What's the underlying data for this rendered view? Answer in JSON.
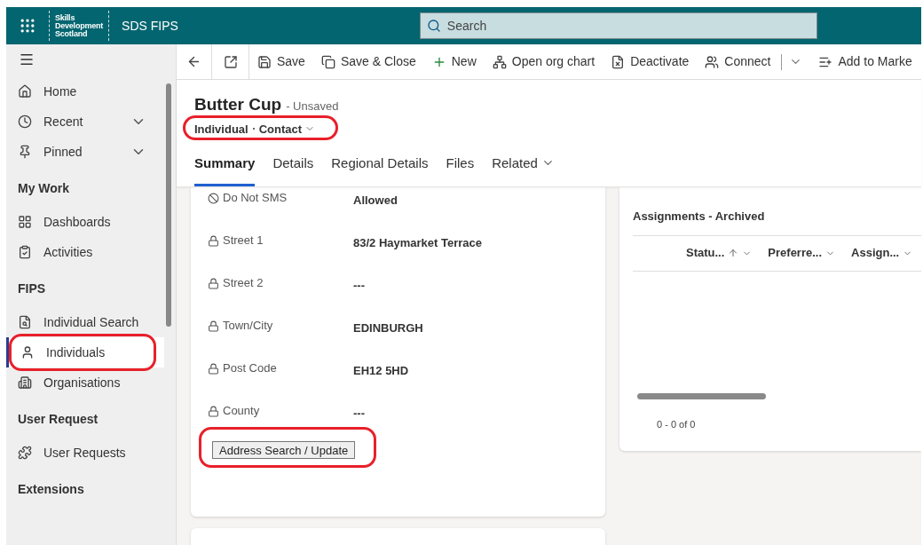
{
  "app_bar": {
    "logo_lines": [
      "Skills",
      "Development",
      "Scotland"
    ],
    "app_name": "SDS FIPS",
    "search": {
      "placeholder": "Search"
    }
  },
  "sidebar": {
    "groups": [
      {
        "items": [
          {
            "label": "Home",
            "expandable": false,
            "selected": false,
            "highlighted": false
          },
          {
            "label": "Recent",
            "expandable": true,
            "selected": false,
            "highlighted": false
          },
          {
            "label": "Pinned",
            "expandable": true,
            "selected": false,
            "highlighted": false
          }
        ]
      },
      {
        "heading": "My Work",
        "items": [
          {
            "label": "Dashboards",
            "expandable": false,
            "selected": false,
            "highlighted": false
          },
          {
            "label": "Activities",
            "expandable": false,
            "selected": false,
            "highlighted": false
          }
        ]
      },
      {
        "heading": "FIPS",
        "items": [
          {
            "label": "Individual Search",
            "expandable": false,
            "selected": false,
            "highlighted": false
          },
          {
            "label": "Individuals",
            "expandable": false,
            "selected": true,
            "highlighted": true
          },
          {
            "label": "Organisations",
            "expandable": false,
            "selected": false,
            "highlighted": false
          }
        ]
      },
      {
        "heading": "User Request",
        "items": [
          {
            "label": "User Requests",
            "expandable": false,
            "selected": false,
            "highlighted": false
          }
        ]
      },
      {
        "heading": "Extensions"
      }
    ]
  },
  "commands": [
    {
      "label": "Save",
      "split": false
    },
    {
      "label": "Save & Close",
      "split": false
    },
    {
      "label": "New",
      "split": false
    },
    {
      "label": "Open org chart",
      "split": false
    },
    {
      "label": "Deactivate",
      "split": false
    },
    {
      "label": "Connect",
      "split": true
    },
    {
      "label": "Add to Marke",
      "split": false
    }
  ],
  "record": {
    "title": "Butter Cup",
    "status": "- Unsaved",
    "entity": "Individual",
    "form": "Contact",
    "highlighted": true
  },
  "tabs": [
    {
      "label": "Summary",
      "selected": true,
      "dropdown": false
    },
    {
      "label": "Details",
      "selected": false,
      "dropdown": false
    },
    {
      "label": "Regional Details",
      "selected": false,
      "dropdown": false
    },
    {
      "label": "Files",
      "selected": false,
      "dropdown": false
    },
    {
      "label": "Related",
      "selected": false,
      "dropdown": true
    }
  ],
  "fields": [
    {
      "label": "Do Not SMS",
      "value": "Allowed",
      "locked": false
    },
    {
      "label": "Street 1",
      "value": "83/2 Haymarket Terrace",
      "locked": true
    },
    {
      "label": "Street 2",
      "value": "---",
      "locked": true
    },
    {
      "label": "Town/City",
      "value": "EDINBURGH",
      "locked": true
    },
    {
      "label": "Post Code",
      "value": "EH12 5HD",
      "locked": true
    },
    {
      "label": "County",
      "value": "---",
      "locked": true
    }
  ],
  "address_button": {
    "label": "Address Search / Update",
    "highlighted": true
  },
  "subgrid": {
    "title": "Assignments - Archived",
    "columns": [
      {
        "label": "Statu...",
        "sorted": true
      },
      {
        "label": "Preferre...",
        "sorted": false
      },
      {
        "label": "Assign...",
        "sorted": false
      }
    ],
    "pager": "0 - 0 of 0"
  }
}
